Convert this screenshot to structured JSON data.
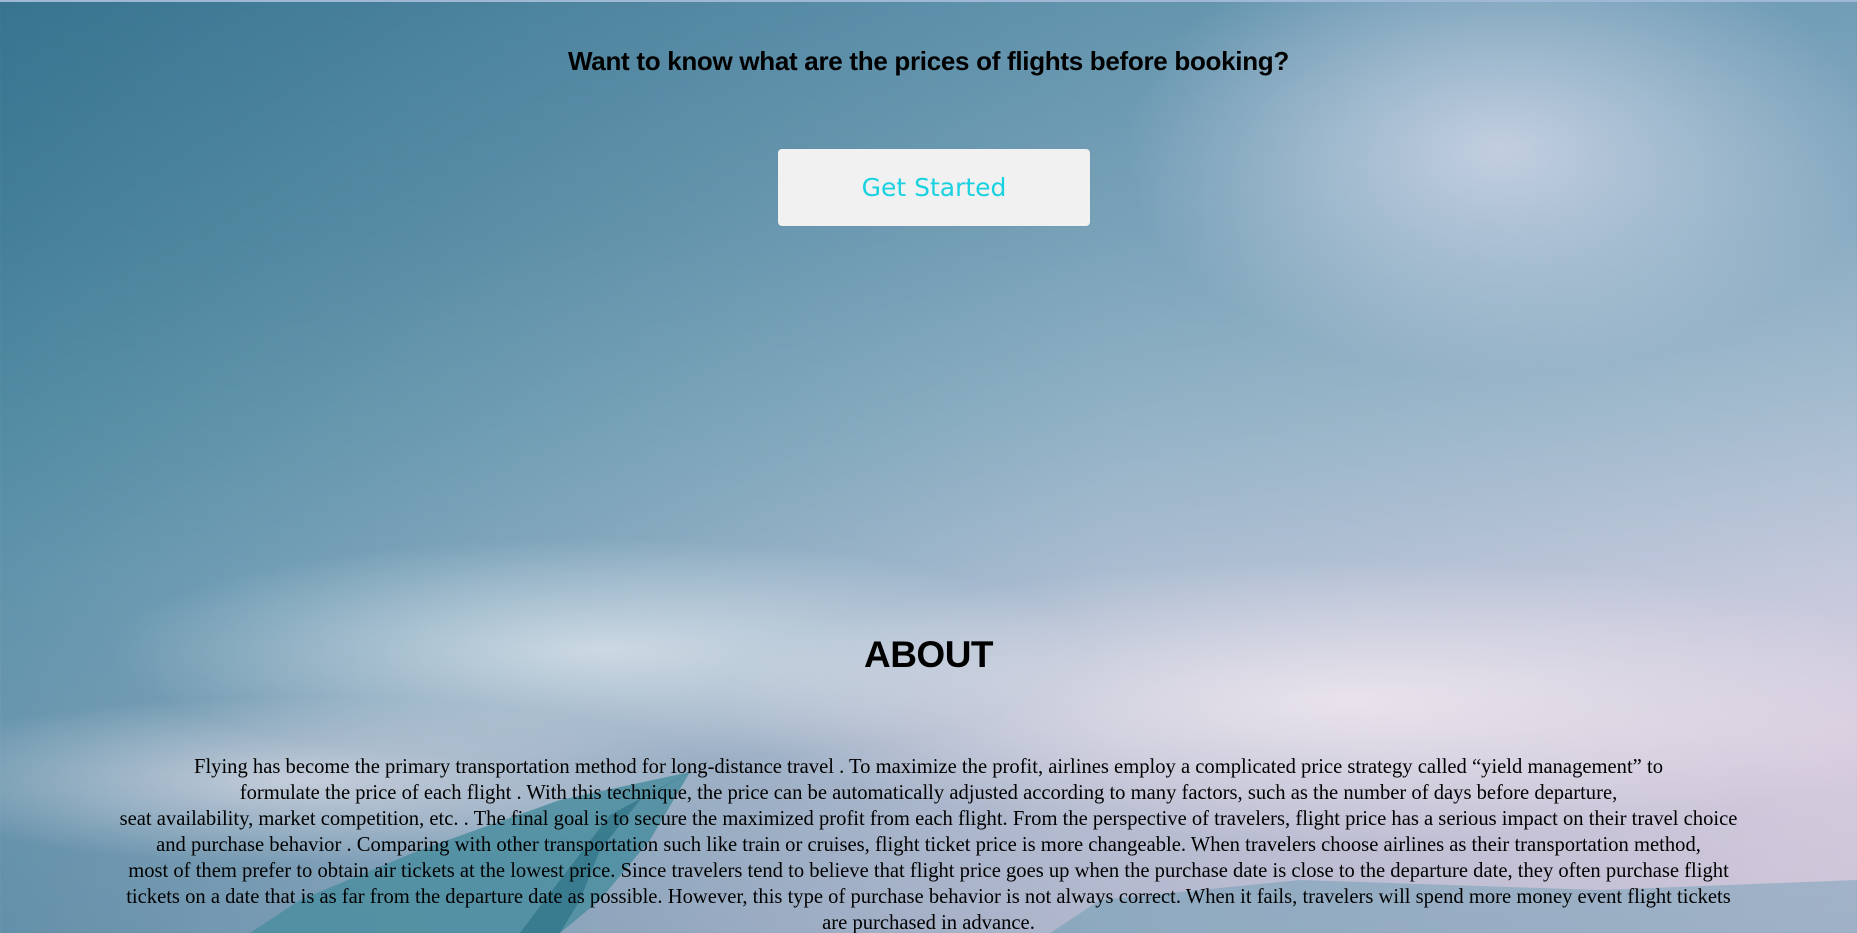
{
  "hero": {
    "headline": "Want to know what are the prices of flights before booking?",
    "cta_label": "Get Started"
  },
  "about": {
    "title": "ABOUT",
    "lines": [
      "Flying has become the primary transportation method for long-distance travel . To maximize the profit, airlines employ a complicated price strategy called “yield management” to",
      "formulate the price of each flight . With this technique, the price can be automatically adjusted according to many factors, such as the number of days before departure,",
      "seat availability, market competition, etc. . The final goal is to secure the maximized profit from each flight. From the perspective of travelers, flight price has a serious impact on their travel choice",
      "and purchase behavior . Comparing with other transportation such like train or cruises, flight ticket price is more changeable. When travelers choose airlines as their transportation method,",
      "most of them prefer to obtain air tickets at the lowest price. Since travelers tend to believe that flight price goes up when the purchase date is close to the departure date, they often purchase flight",
      "tickets on a date that is as far from the departure date as possible. However, this type of purchase behavior is not always correct. When it fails, travelers will spend more money event flight tickets",
      "are purchased in advance."
    ]
  },
  "colors": {
    "cta_text": "#19d1e0",
    "cta_background": "#f1f1f1",
    "sky_top": "#7fb2c4",
    "sky_bottom": "#efe6ee"
  }
}
